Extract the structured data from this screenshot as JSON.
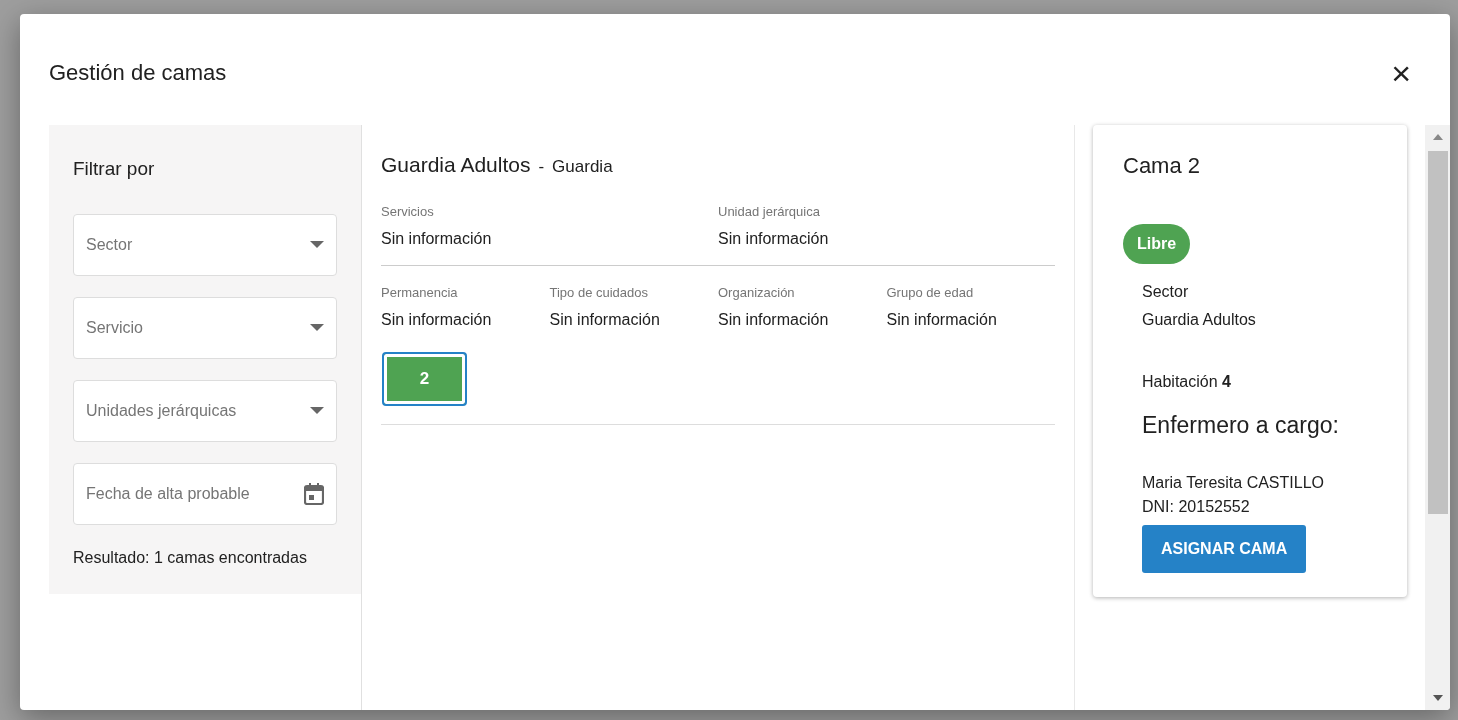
{
  "dialog": {
    "title": "Gestión de camas",
    "close": "×"
  },
  "filters": {
    "title": "Filtrar por",
    "fields": [
      {
        "kind": "select",
        "placeholder": "Sector"
      },
      {
        "kind": "select",
        "placeholder": "Servicio"
      },
      {
        "kind": "select",
        "placeholder": "Unidades jerárquicas"
      },
      {
        "kind": "date",
        "placeholder": "Fecha de alta probable"
      }
    ],
    "result": "Resultado: 1 camas encontradas"
  },
  "sector": {
    "name": "Guardia Adultos",
    "separator": "-",
    "type": "Guardia",
    "summary": [
      {
        "label": "Servicios",
        "value": "Sin información"
      },
      {
        "label": "Unidad jerárquica",
        "value": "Sin información"
      }
    ],
    "attributes": [
      {
        "label": "Permanencia",
        "value": "Sin información"
      },
      {
        "label": "Tipo de cuidados",
        "value": "Sin información"
      },
      {
        "label": "Organización",
        "value": "Sin información"
      },
      {
        "label": "Grupo de edad",
        "value": "Sin información"
      }
    ],
    "beds": [
      {
        "label": "2",
        "selected": true
      }
    ]
  },
  "bed_detail": {
    "title": "Cama 2",
    "status": "Libre",
    "sector_label": "Sector",
    "sector_value": "Guardia Adultos",
    "room": "Habitación **4**",
    "nurse_heading": "Enfermero a cargo:",
    "nurse_name": "Maria Teresita CASTILLO",
    "nurse_dni": "DNI: 20152552",
    "action": "ASIGNAR CAMA"
  }
}
